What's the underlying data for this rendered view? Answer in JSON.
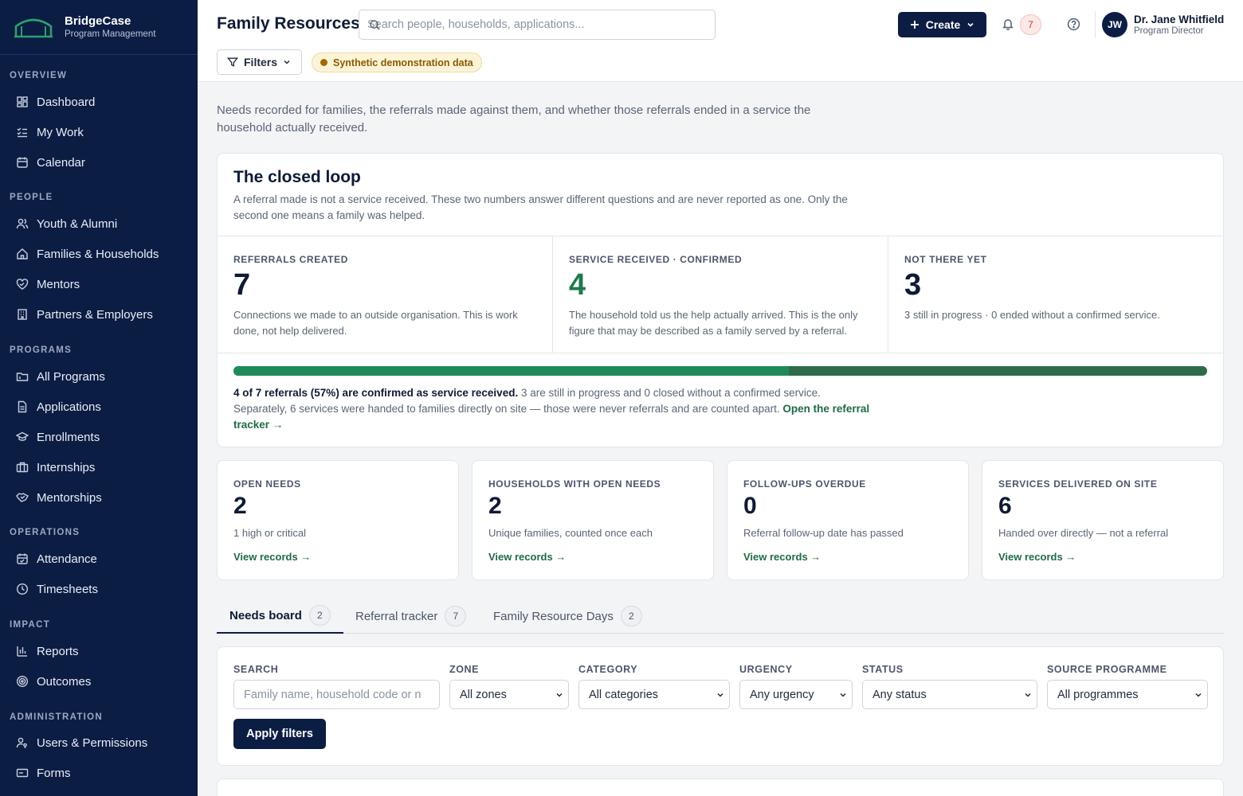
{
  "brand": {
    "name": "BridgeCase",
    "subtitle": "Program Management"
  },
  "sidebar": {
    "sections": [
      {
        "title": "OVERVIEW",
        "items": [
          {
            "label": "Dashboard",
            "icon": "dashboard-icon"
          },
          {
            "label": "My Work",
            "icon": "checklist-icon"
          },
          {
            "label": "Calendar",
            "icon": "calendar-icon"
          }
        ]
      },
      {
        "title": "PEOPLE",
        "items": [
          {
            "label": "Youth & Alumni",
            "icon": "users-icon"
          },
          {
            "label": "Families & Households",
            "icon": "home-icon"
          },
          {
            "label": "Mentors",
            "icon": "heart-handshake-icon"
          },
          {
            "label": "Partners & Employers",
            "icon": "building-icon"
          }
        ]
      },
      {
        "title": "PROGRAMS",
        "items": [
          {
            "label": "All Programs",
            "icon": "folder-icon"
          },
          {
            "label": "Applications",
            "icon": "file-icon"
          },
          {
            "label": "Enrollments",
            "icon": "graduation-cap-icon"
          },
          {
            "label": "Internships",
            "icon": "briefcase-icon"
          },
          {
            "label": "Mentorships",
            "icon": "handshake-icon"
          }
        ]
      },
      {
        "title": "OPERATIONS",
        "items": [
          {
            "label": "Attendance",
            "icon": "calendar-check-icon"
          },
          {
            "label": "Timesheets",
            "icon": "clock-icon"
          }
        ]
      },
      {
        "title": "IMPACT",
        "items": [
          {
            "label": "Reports",
            "icon": "bar-chart-icon"
          },
          {
            "label": "Outcomes",
            "icon": "target-icon"
          }
        ]
      },
      {
        "title": "ADMINISTRATION",
        "items": [
          {
            "label": "Users & Permissions",
            "icon": "user-key-icon"
          },
          {
            "label": "Forms",
            "icon": "form-icon"
          }
        ]
      }
    ]
  },
  "header": {
    "title": "Family Resources",
    "search_placeholder": "Search people, households, applications...",
    "create_label": "Create",
    "notifications_count": "7",
    "user": {
      "initials": "JW",
      "name": "Dr. Jane Whitfield",
      "role": "Program Director"
    },
    "filters_label": "Filters",
    "synthetic_badge": "Synthetic demonstration data"
  },
  "intro": "Needs recorded for families, the referrals made against them, and whether those referrals ended in a service the household actually received.",
  "closed_loop": {
    "title": "The closed loop",
    "description": "A referral made is not a service received. These two numbers answer different questions and are never reported as one. Only the second one means a family was helped.",
    "stats": [
      {
        "label": "REFERRALS CREATED",
        "value": "7",
        "desc": "Connections we made to an outside organisation. This is work done, not help delivered."
      },
      {
        "label": "SERVICE RECEIVED · CONFIRMED",
        "value": "4",
        "desc": "The household told us the help actually arrived. This is the only figure that may be described as a family served by a referral."
      },
      {
        "label": "NOT THERE YET",
        "value": "3",
        "desc": "3 still in progress · 0 ended without a confirmed service."
      }
    ],
    "progress_confirmed_fraction": 0.57,
    "summary_bold": "4 of 7 referrals (57%) are confirmed as service received.",
    "summary_text": " 3 are still in progress and 0 closed without a confirmed service. Separately, 6 services were handed to families directly on site — those were never referrals and are counted apart. ",
    "summary_link": "Open the referral tracker →"
  },
  "kpis": [
    {
      "label": "OPEN NEEDS",
      "value": "2",
      "desc": "1 high or critical",
      "link": "View records →"
    },
    {
      "label": "HOUSEHOLDS WITH OPEN NEEDS",
      "value": "2",
      "desc": "Unique families, counted once each",
      "link": "View records →"
    },
    {
      "label": "FOLLOW-UPS OVERDUE",
      "value": "0",
      "desc": "Referral follow-up date has passed",
      "link": "View records →"
    },
    {
      "label": "SERVICES DELIVERED ON SITE",
      "value": "6",
      "desc": "Handed over directly — not a referral",
      "link": "View records →"
    }
  ],
  "tabs": [
    {
      "label": "Needs board",
      "count": "2",
      "active": true
    },
    {
      "label": "Referral tracker",
      "count": "7",
      "active": false
    },
    {
      "label": "Family Resource Days",
      "count": "2",
      "active": false
    }
  ],
  "filters": {
    "search_label": "SEARCH",
    "search_placeholder": "Family name, household code or n",
    "zone_label": "ZONE",
    "zone_value": "All zones",
    "category_label": "CATEGORY",
    "category_value": "All categories",
    "urgency_label": "URGENCY",
    "urgency_value": "Any urgency",
    "status_label": "STATUS",
    "status_value": "Any status",
    "source_label": "SOURCE PROGRAMME",
    "source_value": "All programmes",
    "apply_label": "Apply filters"
  },
  "colors": {
    "navy": "#0c1d44",
    "green": "#1f7a4c",
    "amber": "#a06a00"
  }
}
